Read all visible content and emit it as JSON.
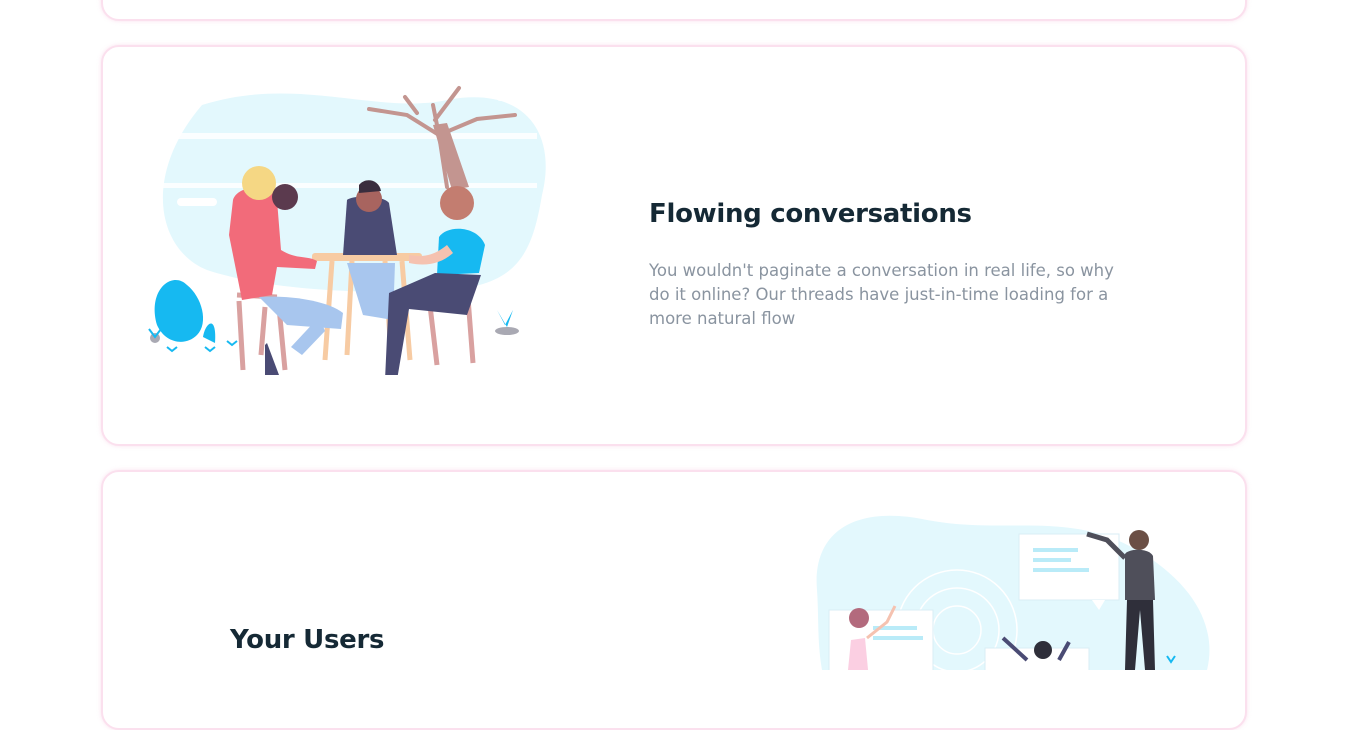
{
  "features": [
    {
      "title": "Flowing conversations",
      "description": "You wouldn't paginate a conversation in real life, so why do it online? Our threads have just-in-time loading for a more natural flow",
      "illustration": "people-talking-at-table-illustration"
    },
    {
      "title": "Your Users",
      "illustration": "users-chat-bubbles-illustration"
    }
  ],
  "colors": {
    "card_border": "#fbe0ee",
    "title": "#152935",
    "body_text": "#8a94a0",
    "blob": "#e3f8fd",
    "accent_blue": "#16b9f1",
    "accent_pink": "#f26b7a"
  }
}
